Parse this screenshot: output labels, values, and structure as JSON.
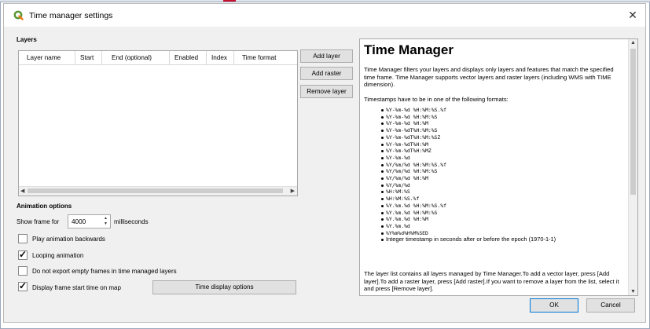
{
  "window": {
    "title": "Time manager settings",
    "close_glyph": "✕"
  },
  "layers": {
    "heading": "Layers",
    "columns": [
      "Layer name",
      "Start",
      "End (optional)",
      "Enabled",
      "Index",
      "Time format"
    ],
    "add_layer": "Add layer",
    "add_raster": "Add raster",
    "remove_layer": "Remove layer"
  },
  "animation": {
    "heading": "Animation options",
    "show_frame_label": "Show frame for",
    "show_frame_value": "4000",
    "units": "milliseconds",
    "options": [
      {
        "label": "Play animation backwards",
        "checked": false
      },
      {
        "label": "Looping animation",
        "checked": true
      },
      {
        "label": "Do not export empty frames in time managed layers",
        "checked": false
      },
      {
        "label": "Display frame start time on map",
        "checked": true
      }
    ],
    "time_display_button": "Time display options"
  },
  "help": {
    "title": "Time Manager",
    "intro": "Time Manager filters your layers and displays only layers and features that match the specified time frame. Time Manager supports vector layers and raster layers (including WMS with TIME dimension).",
    "formats_intro": "Timestamps have to be in one of the following formats:",
    "formats": [
      "%Y-%m-%d %H:%M:%S.%f",
      "%Y-%m-%d %H:%M:%S",
      "%Y-%m-%d %H:%M",
      "%Y-%m-%dT%H:%M:%S",
      "%Y-%m-%dT%H:%M:%SZ",
      "%Y-%m-%dT%H:%M",
      "%Y-%m-%dT%H:%MZ",
      "%Y-%m-%d",
      "%Y/%m/%d %H:%M:%S.%f",
      "%Y/%m/%d %H:%M:%S",
      "%Y/%m/%d %H:%M",
      "%Y/%m/%d",
      "%H:%M:%S",
      "%H:%M:%S.%f",
      "%Y.%m.%d %H:%M:%S.%f",
      "%Y.%m.%d %H:%M:%S",
      "%Y.%m.%d %H:%M",
      "%Y.%m.%d",
      "%Y%m%d%H%M%SED",
      "Integer timestamp in seconds after or before the epoch (1970-1-1)"
    ],
    "outro": "The layer list contains all layers managed by Time Manager.To add a vector layer, press [Add layer].To add a raster layer, press [Add raster].If you want to remove a layer from the list, select it and press [Remove layer]."
  },
  "footer": {
    "ok": "OK",
    "cancel": "Cancel"
  },
  "icons": {
    "app": "qgis-icon",
    "accent": "#589632"
  }
}
